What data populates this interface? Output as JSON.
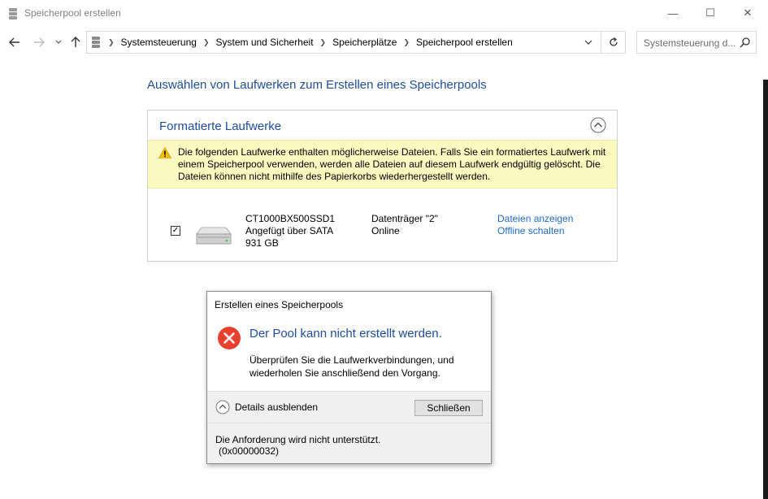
{
  "window": {
    "title": "Speicherpool erstellen",
    "controls": {
      "minimize": "—",
      "maximize": "☐",
      "close": "✕"
    }
  },
  "nav": {
    "breadcrumbs": [
      "Systemsteuerung",
      "System und Sicherheit",
      "Speicherplätze",
      "Speicherpool erstellen"
    ],
    "search_placeholder": "Systemsteuerung d..."
  },
  "main": {
    "heading": "Auswählen von Laufwerken zum Erstellen eines Speicherpools",
    "panel_title": "Formatierte Laufwerke",
    "warning": "Die folgenden Laufwerke enthalten möglicherweise Dateien. Falls Sie ein formatiertes Laufwerk mit einem Speicherpool verwenden, werden alle Dateien auf diesem Laufwerk endgültig gelöscht. Die Dateien können nicht mithilfe des Papierkorbs wiederhergestellt werden.",
    "drive": {
      "checked": true,
      "check_glyph": "✓",
      "model": "CT1000BX500SSD1",
      "connection": "Angefügt über SATA",
      "size": "931 GB",
      "disk": "Datenträger \"2\"",
      "status": "Online",
      "link_view": "Dateien anzeigen",
      "link_offline": "Offline schalten"
    }
  },
  "dialog": {
    "title": "Erstellen eines Speicherpools",
    "main_instruction": "Der Pool kann nicht erstellt werden.",
    "message": "Überprüfen Sie die Laufwerkverbindungen, und wiederholen Sie anschließend den Vorgang.",
    "details_toggle": "Details ausblenden",
    "close_label": "Schließen",
    "details_text": "Die Anforderung wird nicht unterstützt.",
    "details_code": "(0x00000032)"
  },
  "colors": {
    "heading_blue": "#1e4e9b",
    "link_blue": "#1e6cc8",
    "warning_bg": "#fcf9c0",
    "error_red": "#e8402c"
  }
}
